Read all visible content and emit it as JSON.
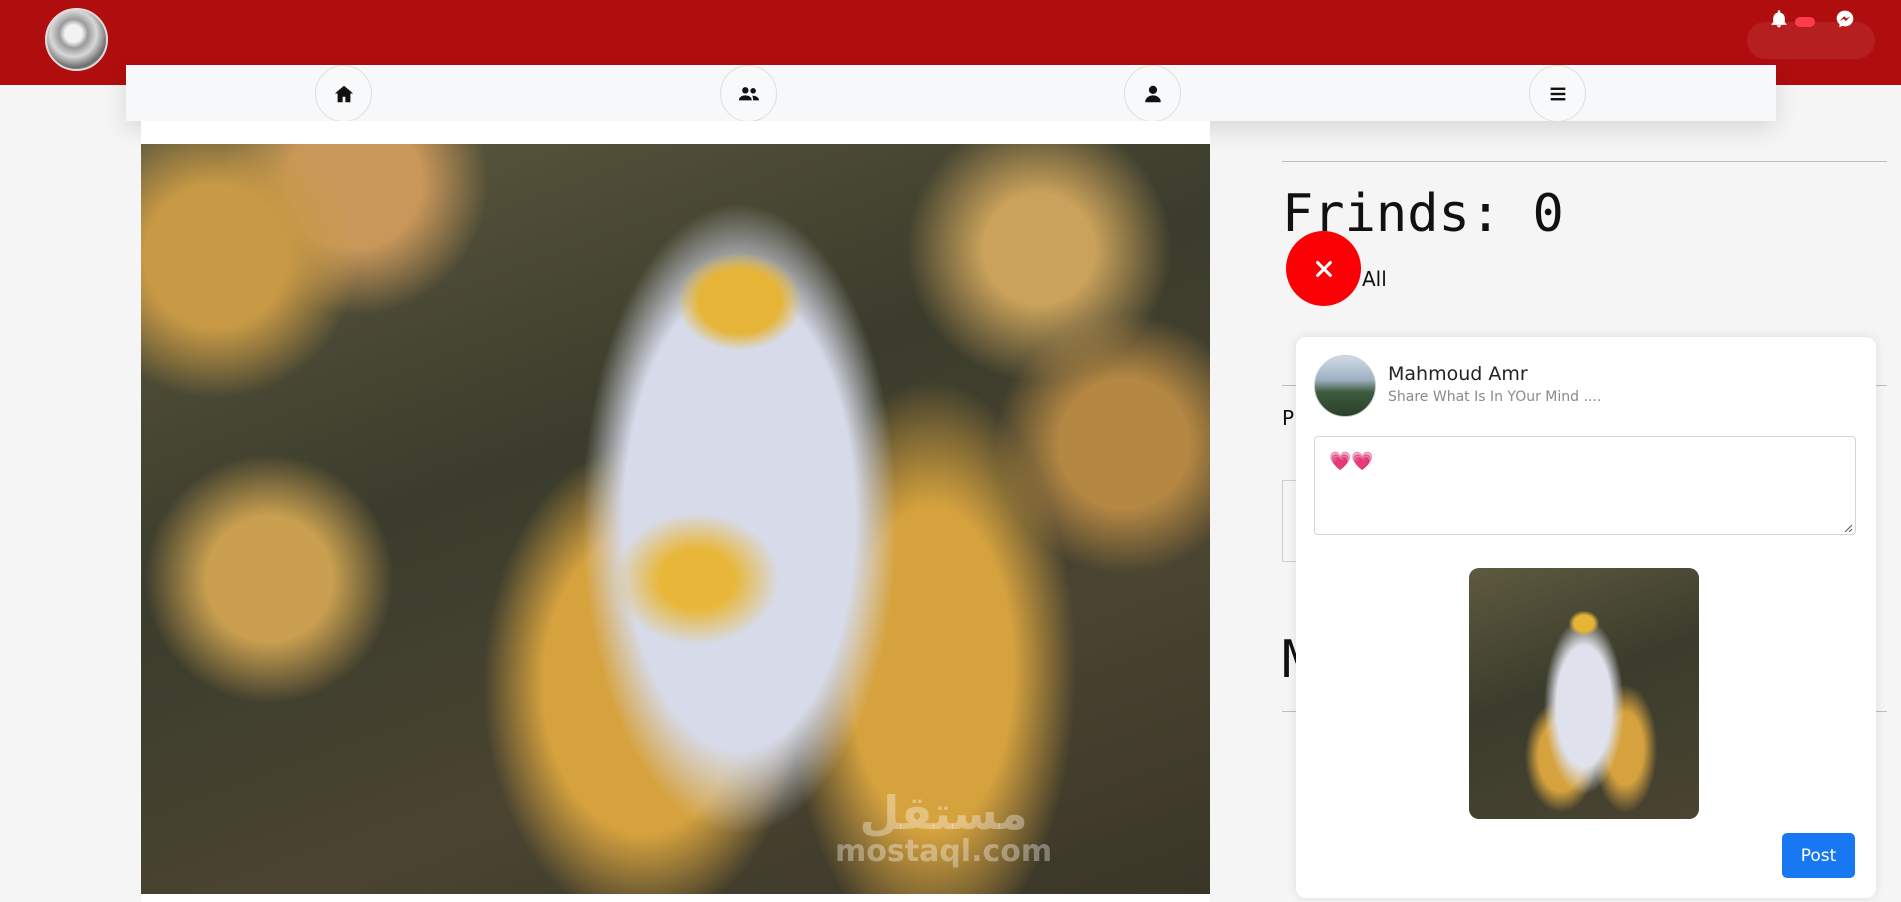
{
  "header": {
    "logo": "horse-logo",
    "notification_icon": "bell-icon",
    "messenger_icon": "messenger-icon"
  },
  "nav": {
    "items": [
      {
        "icon": "home-icon"
      },
      {
        "icon": "users-icon"
      },
      {
        "icon": "user-icon"
      },
      {
        "icon": "menu-icon"
      }
    ]
  },
  "feed": {
    "watermark_ar": "مستقل",
    "watermark_en": "mostaql.com"
  },
  "sidebar": {
    "friends_title": "Frinds: 0",
    "all_link": "All",
    "peek_p": "P",
    "peek_m": "M"
  },
  "create_post": {
    "user_name": "Mahmoud Amr",
    "subtitle": "Share What Is In YOur Mind ....",
    "text_value": "💗💗",
    "post_label": "Post",
    "close_icon": "close-icon"
  },
  "colors": {
    "header": "#b00d0e",
    "close_button": "#fb0004",
    "post_button": "#1877f2"
  }
}
